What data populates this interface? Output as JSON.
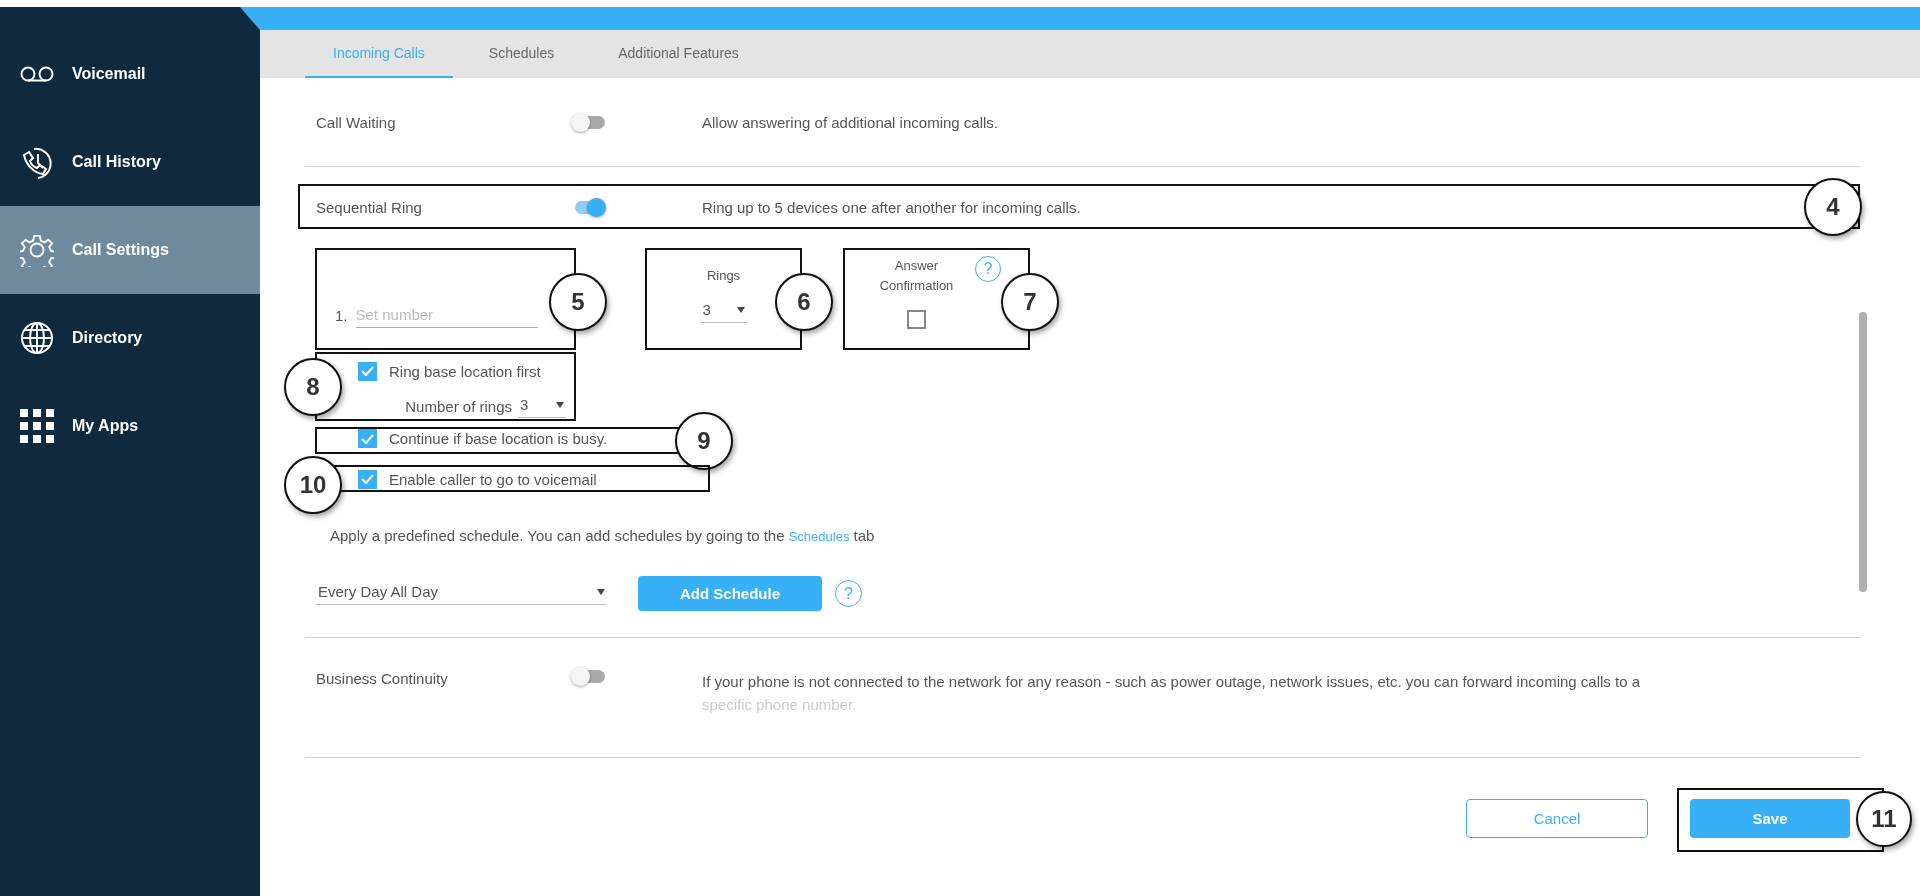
{
  "sidebar": {
    "items": [
      {
        "label": "Voicemail",
        "selected": false
      },
      {
        "label": "Call History",
        "selected": false
      },
      {
        "label": "Call Settings",
        "selected": true
      },
      {
        "label": "Directory",
        "selected": false
      },
      {
        "label": "My Apps",
        "selected": false
      }
    ]
  },
  "tabs": [
    {
      "label": "Incoming Calls",
      "selected": true
    },
    {
      "label": "Schedules",
      "selected": false
    },
    {
      "label": "Additional Features",
      "selected": false
    }
  ],
  "call_waiting": {
    "label": "Call Waiting",
    "on": false,
    "description": "Allow answering of additional incoming calls."
  },
  "sequential_ring": {
    "label": "Sequential Ring",
    "on": true,
    "description": "Ring up to 5 devices one after another for incoming calls.",
    "number_index": "1.",
    "number_placeholder": "Set number",
    "rings_label": "Rings",
    "rings_value": "3",
    "answer_label": "Answer Confirmation",
    "answer_help": "?",
    "answer_checked": false,
    "ring_base": {
      "label": "Ring base location first",
      "checked": true,
      "rings_label": "Number of rings",
      "rings_value": "3"
    },
    "continue_busy": {
      "label": "Continue if base location is busy.",
      "checked": true
    },
    "voicemail": {
      "label": "Enable caller to go to voicemail",
      "checked": true
    },
    "schedule_text": "Apply a predefined schedule. You can add schedules by going to the",
    "schedule_link": "Schedules",
    "schedule_text_end": "tab",
    "schedule_value": "Every Day All Day",
    "add_schedule": "Add Schedule",
    "schedule_help": "?"
  },
  "business_continuity": {
    "label": "Business Continuity",
    "on": false,
    "description": "If your phone is not connected to the network for any reason - such as power outage, network issues, etc. you can forward incoming calls to a",
    "description_faded": "specific phone number."
  },
  "buttons": {
    "cancel": "Cancel",
    "save": "Save"
  },
  "callouts": [
    "4",
    "5",
    "6",
    "7",
    "8",
    "9",
    "10",
    "11"
  ]
}
